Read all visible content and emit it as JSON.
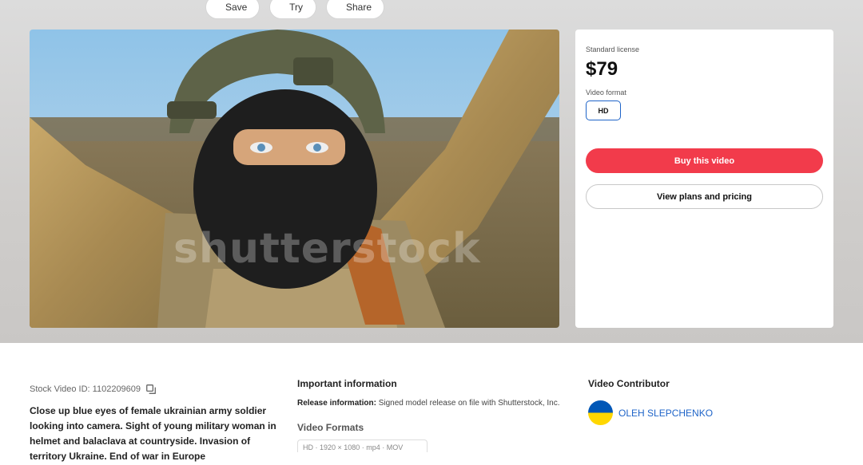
{
  "toolbar": {
    "save_label": "Save",
    "try_label": "Try",
    "share_label": "Share"
  },
  "media": {
    "watermark": "shutterstock"
  },
  "license": {
    "label": "Standard license",
    "price": "$79",
    "format_label": "Video format",
    "format_value": "HD",
    "buy_label": "Buy this video",
    "plans_label": "View plans and pricing"
  },
  "details": {
    "stock_id": "Stock Video ID: 1102209609",
    "description": "Close up blue eyes of female ukrainian army soldier looking into camera. Sight of young military woman in helmet and balaclava at countryside. Invasion of territory Ukraine. End of war in Europe"
  },
  "important": {
    "title": "Important information",
    "release_label": "Release information:",
    "release_text": " Signed model release on file with Shutterstock, Inc.",
    "formats_title": "Video Formats",
    "format_chip": "HD · 1920 × 1080 · mp4 · MOV"
  },
  "contributor": {
    "title": "Video Contributor",
    "name": "OLEH SLEPCHENKO"
  },
  "colors": {
    "accent_blue": "#1e64c8",
    "buy_red": "#f23b4b",
    "flag_blue": "#0057b7",
    "flag_yellow": "#ffd700"
  }
}
